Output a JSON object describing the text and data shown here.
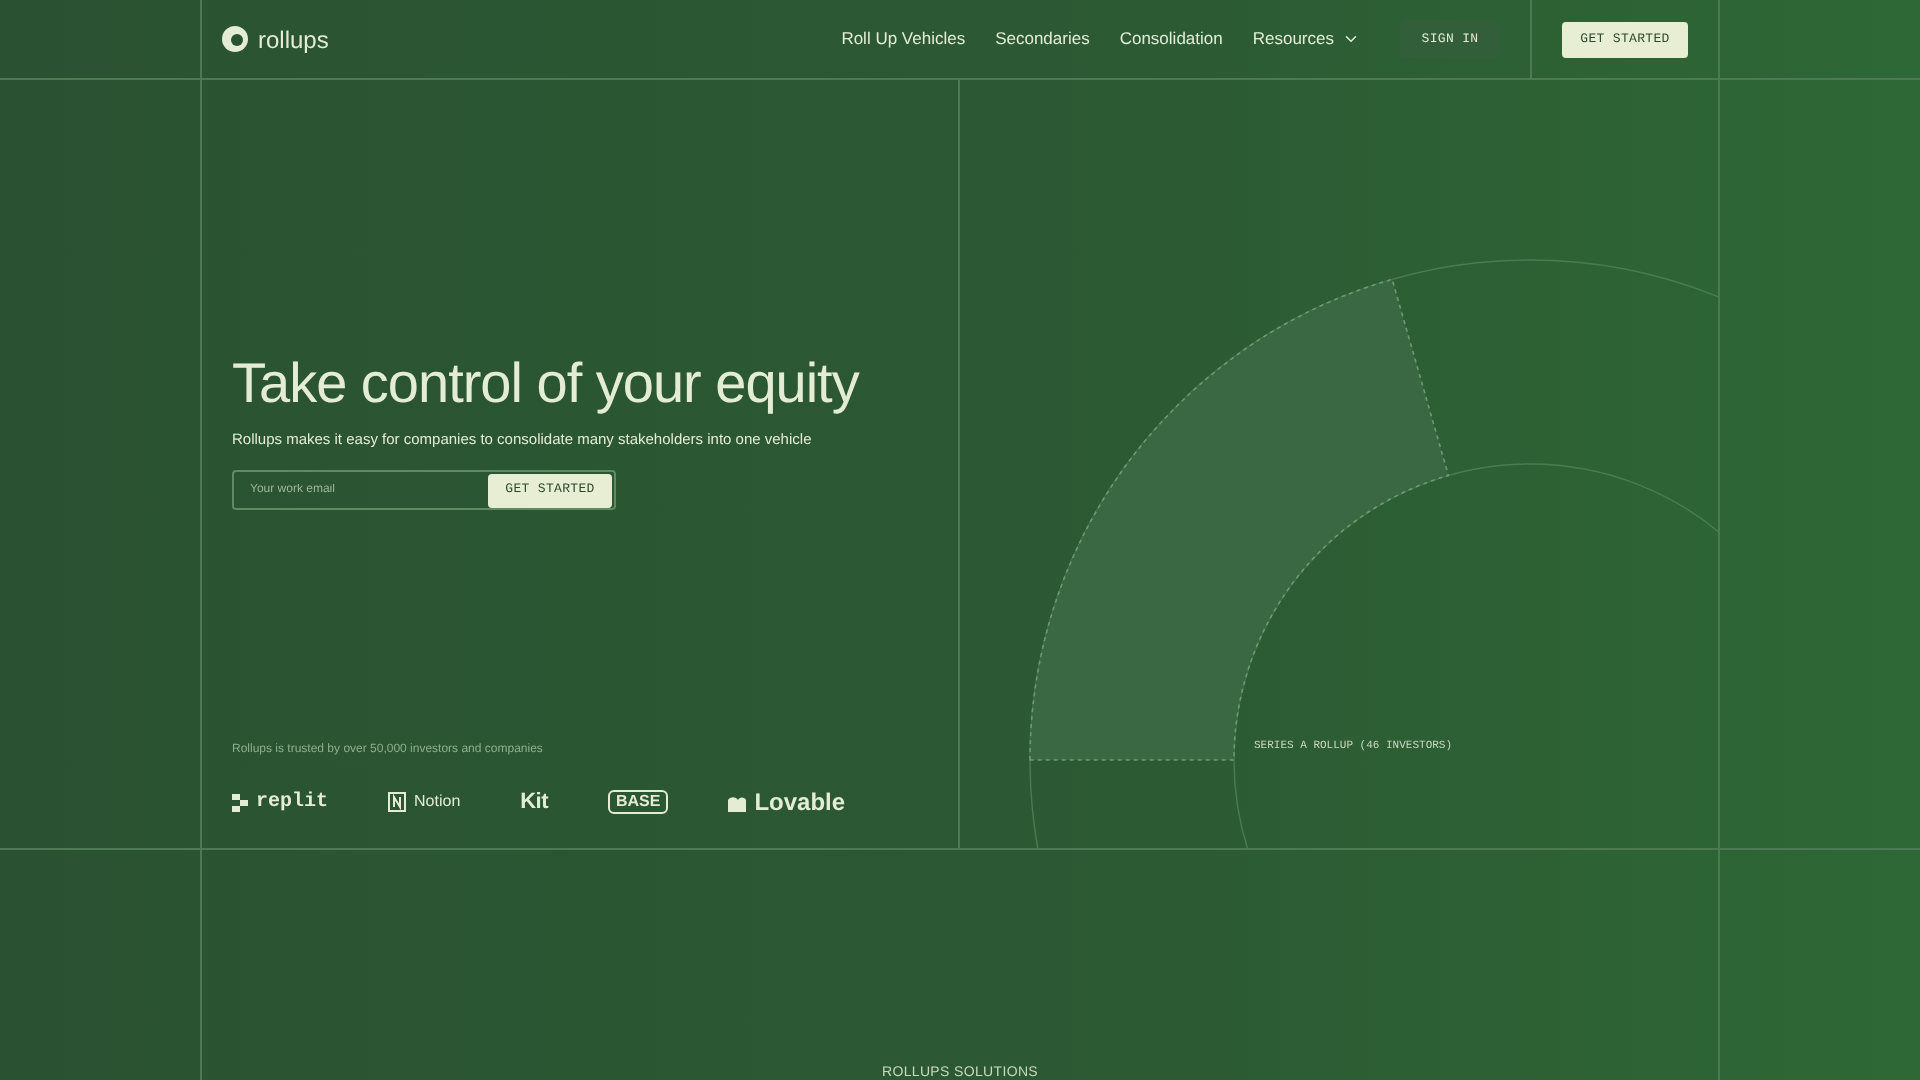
{
  "header": {
    "brand": "rollups",
    "nav": [
      {
        "label": "Roll Up Vehicles",
        "dropdown": false
      },
      {
        "label": "Secondaries",
        "dropdown": false
      },
      {
        "label": "Consolidation",
        "dropdown": false
      },
      {
        "label": "Resources",
        "dropdown": true
      }
    ],
    "sign_in": "SIGN IN",
    "get_started": "GET STARTED"
  },
  "hero": {
    "title": "Take control of your equity",
    "subtitle": "Rollups makes it easy for companies to consolidate many stakeholders into one vehicle",
    "email": {
      "placeholder": "Your work email"
    },
    "cta": "GET STARTED",
    "trusted": "Rollups is trusted by over 50,000 investors and companies",
    "logos": [
      {
        "kind": "replit",
        "label": "replit"
      },
      {
        "kind": "notion",
        "label": "Notion"
      },
      {
        "kind": "kit",
        "label": "Kit"
      },
      {
        "kind": "base",
        "label": "BASE"
      },
      {
        "kind": "lovable",
        "label": "Lovable"
      }
    ]
  },
  "diagram": {
    "label": "SERIES A ROLLUP (46 INVESTORS)"
  },
  "section": {
    "title": "ROLLUPS SOLUTIONS"
  }
}
